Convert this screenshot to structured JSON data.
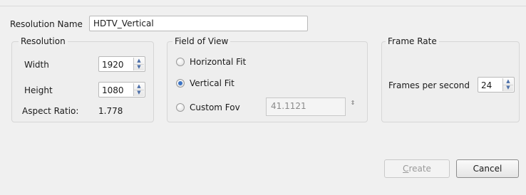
{
  "resolution_name": {
    "label": "Resolution Name",
    "value": "HDTV_Vertical"
  },
  "resolution_group": {
    "title": "Resolution",
    "width_label": "Width",
    "width_value": "1920",
    "height_label": "Height",
    "height_value": "1080",
    "aspect_label": "Aspect Ratio:",
    "aspect_value": "1.778"
  },
  "fov_group": {
    "title": "Field of View",
    "options": [
      {
        "label": "Horizontal Fit",
        "checked": false
      },
      {
        "label": "Vertical Fit",
        "checked": true
      },
      {
        "label": "Custom Fov",
        "checked": false
      }
    ],
    "custom_fov_value": "41.1121",
    "stepper_glyph": "⇕"
  },
  "frame_rate_group": {
    "title": "Frame Rate",
    "fps_label": "Frames per second",
    "fps_value": "24"
  },
  "buttons": {
    "create": "Create",
    "cancel": "Cancel"
  },
  "icons": {
    "spin_up": "▲",
    "spin_down": "▼"
  },
  "colors": {
    "accent": "#3b73c4",
    "background": "#f0f0f0",
    "disabled_text": "#9a9a9a"
  }
}
